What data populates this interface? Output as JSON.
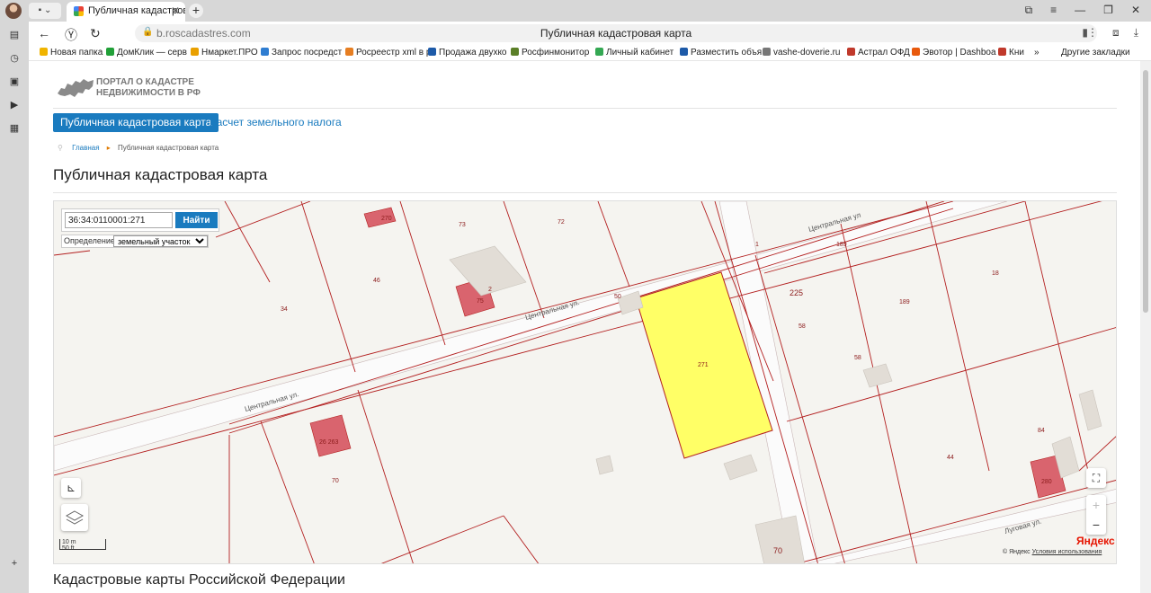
{
  "browser": {
    "tab_title": "Публичная кадастровая карта",
    "tab_group_label": "▪ ⌄",
    "url": "b.roscadastres.com",
    "page_title_center": "Публичная кадастровая карта",
    "bookmarks": [
      {
        "label": "Новая папка ⌄",
        "icon": "folder-icon",
        "color": "#f0b400"
      },
      {
        "label": "ДомКлик — серв",
        "icon": "domclick-icon",
        "color": "#21a038"
      },
      {
        "label": "Нмаркет.ПРО",
        "icon": "nmarket-icon",
        "color": "#e9a000"
      },
      {
        "label": "Запрос посредст",
        "icon": "request-icon",
        "color": "#2f7dd1"
      },
      {
        "label": "Росреестр xml в р",
        "icon": "rosreestr-icon",
        "color": "#e67e22"
      },
      {
        "label": "Продажа двухко",
        "icon": "sale-icon",
        "color": "#1d5aa8"
      },
      {
        "label": "Росфинмонитор",
        "icon": "rosfin-icon",
        "color": "#5b7f28"
      },
      {
        "label": "Личный кабинет",
        "icon": "cabinet-icon",
        "color": "#34a853"
      },
      {
        "label": "Разместить объя",
        "icon": "place-ad-icon",
        "color": "#1d5aa8"
      },
      {
        "label": "vashe-doverie.ru",
        "icon": "help-icon",
        "color": "#777777"
      },
      {
        "label": "Астрал ОФД",
        "icon": "astral-icon",
        "color": "#c0392b"
      },
      {
        "label": "Эвотор | Dashboa",
        "icon": "evotor-icon",
        "color": "#e8590c"
      },
      {
        "label": "Кни",
        "icon": "book-icon",
        "color": "#c0392b"
      }
    ],
    "bookmarks_more": "»",
    "other_bookmarks": "Другие закладки"
  },
  "site": {
    "logo_line1": "ПОРТАЛ О КАДАСТРЕ",
    "logo_line2": "НЕДВИЖИМОСТИ В РФ",
    "nav": {
      "active": "Публичная кадастровая карта",
      "other": "Расчет земельного налога"
    },
    "breadcrumb": {
      "home": "Главная",
      "current": "Публичная кадастровая карта"
    },
    "page_title": "Публичная кадастровая карта",
    "section_title": "Кадастровые карты Российской Федерации"
  },
  "map": {
    "search_value": "36:34:0110001:271",
    "search_button": "Найти",
    "definition_label": "Определение:",
    "definition_value": "земельный участок",
    "definition_options": [
      "земельный участок"
    ],
    "zoom_in": "+",
    "zoom_out": "−",
    "scale_m": "10 m",
    "scale_ft": "50 ft",
    "yandex": "Яндекс",
    "copyright": "© Яндекс",
    "terms_link": "Условия использования",
    "colors": {
      "parcel_border": "#b31f1f",
      "highlight_fill": "#ffff66",
      "building_fill": "#d9646e",
      "road": "#ffffff"
    },
    "street_labels": [
      "Центральная ул.",
      "Центральная ул.",
      "Центральная ул",
      "Луговая ул."
    ],
    "parcel_labels": [
      "270",
      "73",
      "72",
      "46",
      "34",
      "75",
      "2",
      "50",
      "271",
      "225",
      "58",
      "58",
      "189",
      "18",
      "189",
      "84",
      "44",
      "280",
      "26 263",
      "70",
      "70",
      "1"
    ]
  }
}
